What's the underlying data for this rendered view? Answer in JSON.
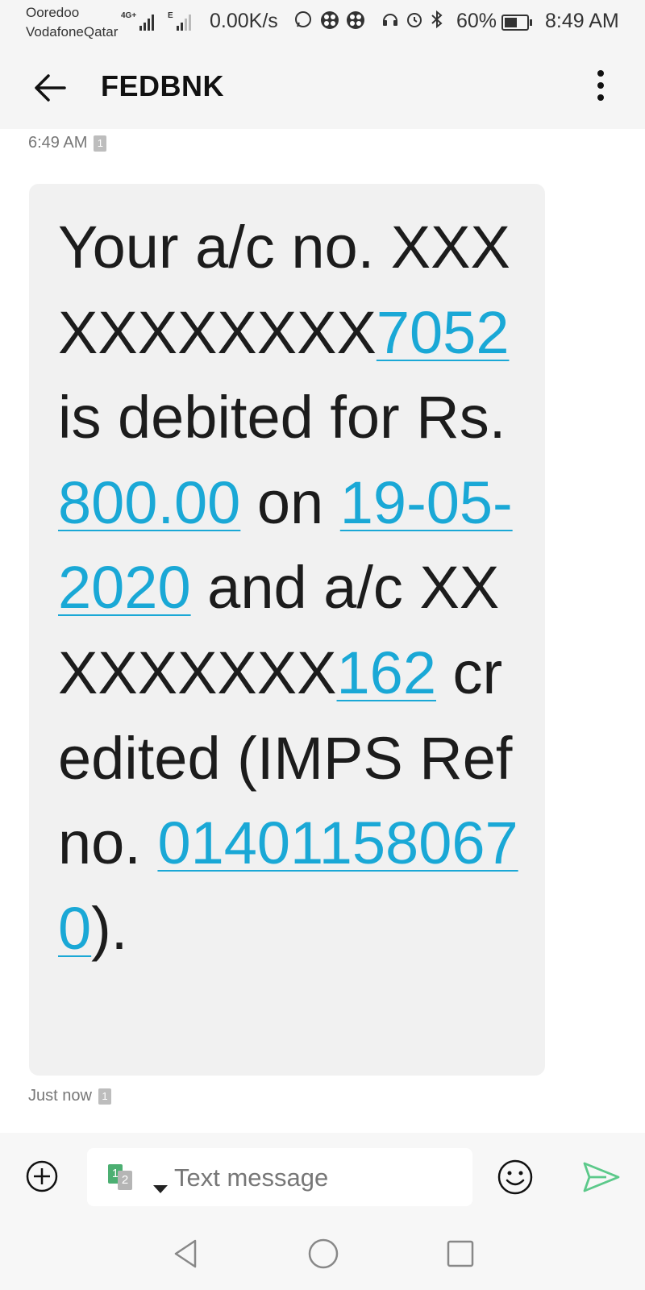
{
  "status_bar": {
    "carrier_1": "Ooredoo",
    "carrier_2": "VodafoneQatar",
    "network_type_1": "4G+",
    "network_type_2": "E",
    "net_speed": "0.00K/s",
    "battery_pct": "60%",
    "battery_level": 0.6,
    "time": "8:49 AM"
  },
  "app_bar": {
    "title": "FEDBNK"
  },
  "conversation": {
    "message_time": "6:49 AM",
    "message_sim": "1",
    "message_segments": [
      {
        "text": "Your a/c no. XXXXXXXXXXX",
        "link": false
      },
      {
        "text": "7052",
        "link": true
      },
      {
        "text": " is debited for Rs.",
        "link": false
      },
      {
        "text": "800.00",
        "link": true
      },
      {
        "text": " on ",
        "link": false
      },
      {
        "text": "19-05-2020",
        "link": true
      },
      {
        "text": " and a/c XXXXXXXXX",
        "link": false
      },
      {
        "text": "162",
        "link": true
      },
      {
        "text": " credited (IMPS Ref no. ",
        "link": false
      },
      {
        "text": "014011580670",
        "link": true
      },
      {
        "text": ").",
        "link": false
      }
    ],
    "status_text": "Just now",
    "status_sim": "1"
  },
  "composer": {
    "placeholder": "Text message",
    "sim_primary": "1",
    "sim_secondary": "2"
  },
  "colors": {
    "link": "#1aa8d6",
    "send": "#5cc98a",
    "bubble": "#f1f1f1",
    "sim_active": "#4caf72"
  },
  "icons": {
    "back": "arrow-left-icon",
    "more": "more-vertical-icon",
    "add": "plus-circle-icon",
    "emoji": "smiley-icon",
    "send": "send-icon",
    "nav_back": "triangle-back-icon",
    "nav_home": "circle-home-icon",
    "nav_recent": "square-recents-icon"
  }
}
